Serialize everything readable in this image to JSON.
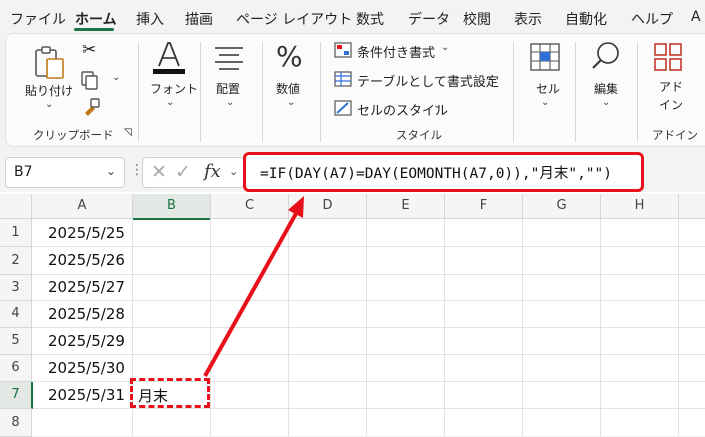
{
  "menu": {
    "items": [
      "ファイル",
      "ホーム",
      "挿入",
      "描画",
      "ページ レイアウト",
      "数式",
      "データ",
      "校閲",
      "表示",
      "自動化",
      "ヘルプ",
      "A"
    ]
  },
  "ribbon": {
    "paste_label": "貼り付け",
    "clipboard_group": "クリップボード",
    "font_label": "フォント",
    "align_label": "配置",
    "number_label": "数値",
    "conditional_format": "条件付き書式",
    "format_as_table": "テーブルとして書式設定",
    "cell_styles": "セルのスタイル",
    "style_group": "スタイル",
    "cells_label": "セル",
    "edit_label": "編集",
    "addin_label_1": "アド",
    "addin_label_2": "イン",
    "addin_group": "アドイン"
  },
  "formula_bar": {
    "name_box": "B7",
    "fx": "fx",
    "formula": "=IF(DAY(A7)=DAY(EOMONTH(A7,0)),\"月末\",\"\")"
  },
  "sheet": {
    "columns": [
      "A",
      "B",
      "C",
      "D",
      "E",
      "F",
      "G",
      "H"
    ],
    "rows": [
      "1",
      "2",
      "3",
      "4",
      "5",
      "6",
      "7",
      "8"
    ],
    "col_a": [
      "2025/5/25",
      "2025/5/26",
      "2025/5/27",
      "2025/5/28",
      "2025/5/29",
      "2025/5/30",
      "2025/5/31"
    ],
    "b7": "月末"
  },
  "colors": {
    "accent": "#1a7343",
    "highlight": "#e8101a"
  }
}
